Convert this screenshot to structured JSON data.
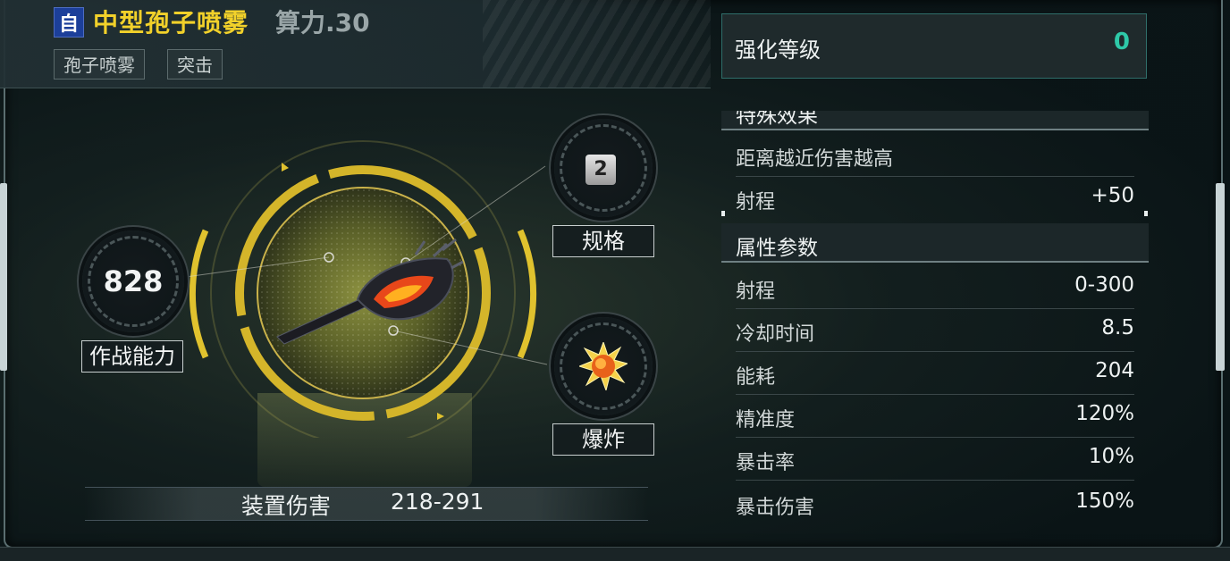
{
  "header": {
    "auto_badge": "自",
    "weapon_name": "中型孢子喷雾",
    "compute_power": "算力.30",
    "tags": [
      "孢子喷雾",
      "突击"
    ]
  },
  "enhance": {
    "label": "强化等级",
    "value": "0"
  },
  "special_effects": {
    "title": "特殊效果",
    "rows": [
      {
        "label": "距离越近伤害越高",
        "value": ""
      },
      {
        "label": "射程",
        "value": "+50"
      }
    ]
  },
  "attributes": {
    "title": "属性参数",
    "rows": [
      {
        "label": "射程",
        "value": "0-300"
      },
      {
        "label": "冷却时间",
        "value": "8.5"
      },
      {
        "label": "能耗",
        "value": "204"
      },
      {
        "label": "精准度",
        "value": "120%"
      },
      {
        "label": "暴击率",
        "value": "10%"
      },
      {
        "label": "暴击伤害",
        "value": "150%"
      }
    ]
  },
  "combat_power": {
    "value": "828",
    "label": "作战能力"
  },
  "spec": {
    "value": "2",
    "label": "规格"
  },
  "damage_type": {
    "label": "爆炸",
    "icon": "explosion-icon"
  },
  "device_damage": {
    "label": "装置伤害",
    "value": "218-291"
  },
  "colors": {
    "title_yellow": "#f2d12a",
    "accent_teal": "#2ec9a8",
    "ring_gold": "#d4b52a"
  }
}
